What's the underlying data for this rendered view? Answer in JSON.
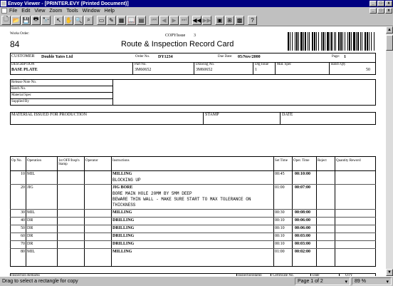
{
  "window": {
    "title": "Envoy Viewer - [PRINTER.EVY (Printed Document)]",
    "min_label": "_",
    "max_label": "□",
    "close_label": "x"
  },
  "menu": [
    "File",
    "Edit",
    "View",
    "Zoom",
    "Tools",
    "Window",
    "Help"
  ],
  "menu_right": {
    "min": "_",
    "restore": "□",
    "close": "x"
  },
  "toolbar": {
    "buttons": [
      {
        "name": "new-icon",
        "glyph": "🗋",
        "enabled": true
      },
      {
        "name": "open-icon",
        "glyph": "📂",
        "enabled": true
      },
      {
        "name": "save-icon",
        "glyph": "💾",
        "enabled": true
      },
      {
        "name": "print-icon",
        "glyph": "🖶",
        "enabled": true
      },
      {
        "name": "find-icon",
        "glyph": "🔭",
        "enabled": true
      },
      {
        "name": "pointer-icon",
        "glyph": "↖",
        "enabled": true
      },
      {
        "name": "hand-icon",
        "glyph": "✋",
        "enabled": true
      },
      {
        "name": "zoom-icon",
        "glyph": "🔍",
        "enabled": true
      },
      {
        "name": "zoom-rect-icon",
        "glyph": "⌕",
        "enabled": true
      },
      {
        "name": "note-icon",
        "glyph": "▭",
        "enabled": true
      },
      {
        "name": "highlight-icon",
        "glyph": "✎",
        "enabled": true
      },
      {
        "name": "thumbnails-icon",
        "glyph": "▦",
        "enabled": true
      },
      {
        "name": "bookmark-icon",
        "glyph": "📖",
        "enabled": true
      },
      {
        "name": "fit-icon",
        "glyph": "▤",
        "enabled": true
      },
      {
        "name": "first-page-icon",
        "glyph": "⏮",
        "enabled": false
      },
      {
        "name": "prev-page-icon",
        "glyph": "◀",
        "enabled": false
      },
      {
        "name": "next-page-icon",
        "glyph": "▶",
        "enabled": false
      },
      {
        "name": "last-page-icon",
        "glyph": "⏭",
        "enabled": false
      },
      {
        "name": "back-icon",
        "glyph": "◀◀",
        "enabled": true
      },
      {
        "name": "forward-icon",
        "glyph": "▶▶",
        "enabled": false
      },
      {
        "name": "page-setup-icon",
        "glyph": "▣",
        "enabled": true
      },
      {
        "name": "grid-icon",
        "glyph": "⊞",
        "enabled": true
      },
      {
        "name": "properties-icon",
        "glyph": "▩",
        "enabled": true
      },
      {
        "name": "help-icon",
        "glyph": "?",
        "enabled": true
      }
    ]
  },
  "doc": {
    "works_order_label": "Works Order:",
    "works_order": "84",
    "copy_issue_label": "COPYIssue",
    "copy_issue": "3",
    "title": "Route & Inspection Record Card",
    "customer_label": "CUSTOMER",
    "customer": "Double Yates Ltd",
    "order_no_label": "Order No.",
    "order_no": "DY1234",
    "due_date_label": "Due Date:",
    "due_date": "05/Nov/2000",
    "page_label": "Page:",
    "page": "1",
    "description_label": "DESCRIPTION",
    "description": "BASE PLATE",
    "part_no_label": "Part No.",
    "part_no": "3M60652",
    "drawing_no_label": "Drawing No.",
    "drawing_no": "3M60652",
    "drg_issue_label": "Drg Issue",
    "drg_issue": "1",
    "mat_spec_label": "Mat. Spec",
    "batch_qty_label": "Batch Qty",
    "batch_qty": "50",
    "release_label": "Release Note No.",
    "batch_no_label": "Batch No.",
    "material_spec_label": "Material Spec",
    "supplied_by_label": "Supplied By",
    "material_issued_label": "MATERIAL ISSUED FOR PRODUCTION",
    "stamp_label": "STAMP",
    "date_label": "DATE",
    "headers": {
      "op": "Op No.",
      "operation": "Operation",
      "first_off": "1st OFF/Insp'n Stamp",
      "operator": "Operator",
      "instructions": "Instructions",
      "set_time": "Set Time",
      "oper_time": "Oper. Time",
      "reject": "Reject",
      "qty_reword": "Quantity Reword"
    },
    "ops": [
      {
        "op": "10",
        "operation": "MIL",
        "instr": "MILLING",
        "lines": [
          "BLOCKING UP"
        ],
        "set": "00:45",
        "oper": "00:10:00"
      },
      {
        "op": "20",
        "operation": "JIG",
        "instr": "JIG BORE",
        "lines": [
          "BORE MAIN HOLE 20MM BY 5MM DEEP",
          "BEWARE THIN WALL - MAKE SURE START TO MAX TOLERANCE ON",
          "THICKNESS"
        ],
        "set": "01:00",
        "oper": "00:07:00"
      },
      {
        "op": "30",
        "operation": "MIL",
        "instr": "MILLING",
        "lines": [],
        "set": "00:30",
        "oper": "00:08:00"
      },
      {
        "op": "40",
        "operation": "DR",
        "instr": "DRILLING",
        "lines": [],
        "set": "00:10",
        "oper": "00:06:00"
      },
      {
        "op": "50",
        "operation": "DR",
        "instr": "DRILLING",
        "lines": [],
        "set": "00:10",
        "oper": "00:06:00"
      },
      {
        "op": "60",
        "operation": "DR",
        "instr": "DRILLING",
        "lines": [],
        "set": "00:10",
        "oper": "00:03:00"
      },
      {
        "op": "70",
        "operation": "DR",
        "instr": "DRILLING",
        "lines": [],
        "set": "00:10",
        "oper": "00:03:00"
      },
      {
        "op": "80",
        "operation": "MIL",
        "instr": "MILLING",
        "lines": [],
        "set": "01:00",
        "oper": "00:02:00"
      }
    ],
    "insp_headers": {
      "remarks": "Inspection Remarks",
      "stamp": "InspectionStamp",
      "cert": "Certificate No.",
      "date": "Date",
      "qty": "QTY"
    }
  },
  "status": {
    "message": "Drag to select a rectangle for copy",
    "page": "Page 1 of 2",
    "zoom": "89 %"
  }
}
